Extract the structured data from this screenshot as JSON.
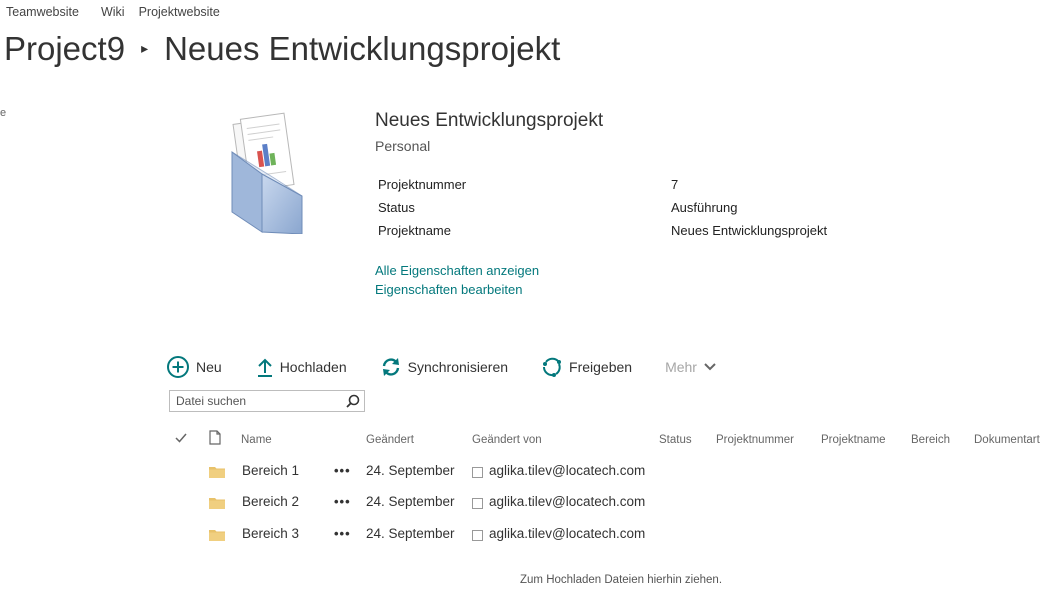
{
  "topnav": {
    "items": [
      "Teamwebsite",
      "Wiki",
      "Projektwebsite"
    ]
  },
  "breadcrumb": {
    "site": "Project9",
    "page": "Neues Entwicklungsprojekt"
  },
  "info": {
    "title": "Neues Entwicklungsprojekt",
    "subtitle": "Personal",
    "properties": [
      {
        "label": "Projektnummer",
        "value": "7"
      },
      {
        "label": "Status",
        "value": "Ausführung"
      },
      {
        "label": "Projektname",
        "value": "Neues Entwicklungsprojekt"
      }
    ],
    "links": [
      "Alle Eigenschaften anzeigen",
      "Eigenschaften bearbeiten"
    ]
  },
  "toolbar": {
    "new_label": "Neu",
    "upload_label": "Hochladen",
    "sync_label": "Synchronisieren",
    "share_label": "Freigeben",
    "more_label": "Mehr"
  },
  "search": {
    "placeholder": "Datei suchen",
    "value": ""
  },
  "columns": [
    "Name",
    "Geändert",
    "Geändert von",
    "Status",
    "Projektnummer",
    "Projektname",
    "Bereich",
    "Dokumentart"
  ],
  "rows": [
    {
      "name": "Bereich 1",
      "modified": "24. September",
      "modified_by": "aglika.tilev@locatech.com"
    },
    {
      "name": "Bereich 2",
      "modified": "24. September",
      "modified_by": "aglika.tilev@locatech.com"
    },
    {
      "name": "Bereich 3",
      "modified": "24. September",
      "modified_by": "aglika.tilev@locatech.com"
    }
  ],
  "row_menu": "•••",
  "dropzone": "Zum Hochladen Dateien hierhin ziehen.",
  "edge_glyph": "e",
  "icons": [
    "doc-library-icon",
    "plus-circle-icon",
    "upload-arrow-icon",
    "sync-icon",
    "share-icon",
    "chevron-down-icon",
    "search-icon",
    "checkmark-icon",
    "file-type-icon",
    "folder-icon"
  ],
  "colors": {
    "link": "#03787c",
    "accent": "#03787c",
    "folder": "#e8c26a",
    "muted": "#a6a6a6"
  }
}
